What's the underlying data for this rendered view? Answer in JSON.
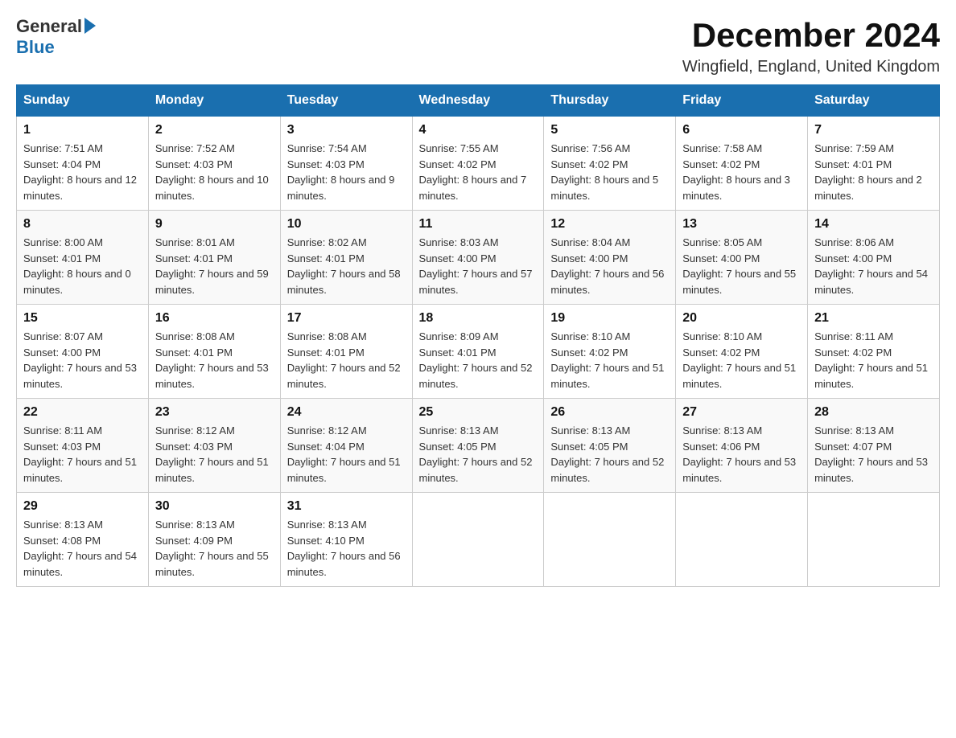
{
  "header": {
    "title": "December 2024",
    "location": "Wingfield, England, United Kingdom",
    "logo_general": "General",
    "logo_blue": "Blue"
  },
  "days_of_week": [
    "Sunday",
    "Monday",
    "Tuesday",
    "Wednesday",
    "Thursday",
    "Friday",
    "Saturday"
  ],
  "weeks": [
    [
      {
        "day": "1",
        "sunrise": "7:51 AM",
        "sunset": "4:04 PM",
        "daylight": "8 hours and 12 minutes."
      },
      {
        "day": "2",
        "sunrise": "7:52 AM",
        "sunset": "4:03 PM",
        "daylight": "8 hours and 10 minutes."
      },
      {
        "day": "3",
        "sunrise": "7:54 AM",
        "sunset": "4:03 PM",
        "daylight": "8 hours and 9 minutes."
      },
      {
        "day": "4",
        "sunrise": "7:55 AM",
        "sunset": "4:02 PM",
        "daylight": "8 hours and 7 minutes."
      },
      {
        "day": "5",
        "sunrise": "7:56 AM",
        "sunset": "4:02 PM",
        "daylight": "8 hours and 5 minutes."
      },
      {
        "day": "6",
        "sunrise": "7:58 AM",
        "sunset": "4:02 PM",
        "daylight": "8 hours and 3 minutes."
      },
      {
        "day": "7",
        "sunrise": "7:59 AM",
        "sunset": "4:01 PM",
        "daylight": "8 hours and 2 minutes."
      }
    ],
    [
      {
        "day": "8",
        "sunrise": "8:00 AM",
        "sunset": "4:01 PM",
        "daylight": "8 hours and 0 minutes."
      },
      {
        "day": "9",
        "sunrise": "8:01 AM",
        "sunset": "4:01 PM",
        "daylight": "7 hours and 59 minutes."
      },
      {
        "day": "10",
        "sunrise": "8:02 AM",
        "sunset": "4:01 PM",
        "daylight": "7 hours and 58 minutes."
      },
      {
        "day": "11",
        "sunrise": "8:03 AM",
        "sunset": "4:00 PM",
        "daylight": "7 hours and 57 minutes."
      },
      {
        "day": "12",
        "sunrise": "8:04 AM",
        "sunset": "4:00 PM",
        "daylight": "7 hours and 56 minutes."
      },
      {
        "day": "13",
        "sunrise": "8:05 AM",
        "sunset": "4:00 PM",
        "daylight": "7 hours and 55 minutes."
      },
      {
        "day": "14",
        "sunrise": "8:06 AM",
        "sunset": "4:00 PM",
        "daylight": "7 hours and 54 minutes."
      }
    ],
    [
      {
        "day": "15",
        "sunrise": "8:07 AM",
        "sunset": "4:00 PM",
        "daylight": "7 hours and 53 minutes."
      },
      {
        "day": "16",
        "sunrise": "8:08 AM",
        "sunset": "4:01 PM",
        "daylight": "7 hours and 53 minutes."
      },
      {
        "day": "17",
        "sunrise": "8:08 AM",
        "sunset": "4:01 PM",
        "daylight": "7 hours and 52 minutes."
      },
      {
        "day": "18",
        "sunrise": "8:09 AM",
        "sunset": "4:01 PM",
        "daylight": "7 hours and 52 minutes."
      },
      {
        "day": "19",
        "sunrise": "8:10 AM",
        "sunset": "4:02 PM",
        "daylight": "7 hours and 51 minutes."
      },
      {
        "day": "20",
        "sunrise": "8:10 AM",
        "sunset": "4:02 PM",
        "daylight": "7 hours and 51 minutes."
      },
      {
        "day": "21",
        "sunrise": "8:11 AM",
        "sunset": "4:02 PM",
        "daylight": "7 hours and 51 minutes."
      }
    ],
    [
      {
        "day": "22",
        "sunrise": "8:11 AM",
        "sunset": "4:03 PM",
        "daylight": "7 hours and 51 minutes."
      },
      {
        "day": "23",
        "sunrise": "8:12 AM",
        "sunset": "4:03 PM",
        "daylight": "7 hours and 51 minutes."
      },
      {
        "day": "24",
        "sunrise": "8:12 AM",
        "sunset": "4:04 PM",
        "daylight": "7 hours and 51 minutes."
      },
      {
        "day": "25",
        "sunrise": "8:13 AM",
        "sunset": "4:05 PM",
        "daylight": "7 hours and 52 minutes."
      },
      {
        "day": "26",
        "sunrise": "8:13 AM",
        "sunset": "4:05 PM",
        "daylight": "7 hours and 52 minutes."
      },
      {
        "day": "27",
        "sunrise": "8:13 AM",
        "sunset": "4:06 PM",
        "daylight": "7 hours and 53 minutes."
      },
      {
        "day": "28",
        "sunrise": "8:13 AM",
        "sunset": "4:07 PM",
        "daylight": "7 hours and 53 minutes."
      }
    ],
    [
      {
        "day": "29",
        "sunrise": "8:13 AM",
        "sunset": "4:08 PM",
        "daylight": "7 hours and 54 minutes."
      },
      {
        "day": "30",
        "sunrise": "8:13 AM",
        "sunset": "4:09 PM",
        "daylight": "7 hours and 55 minutes."
      },
      {
        "day": "31",
        "sunrise": "8:13 AM",
        "sunset": "4:10 PM",
        "daylight": "7 hours and 56 minutes."
      },
      null,
      null,
      null,
      null
    ]
  ]
}
